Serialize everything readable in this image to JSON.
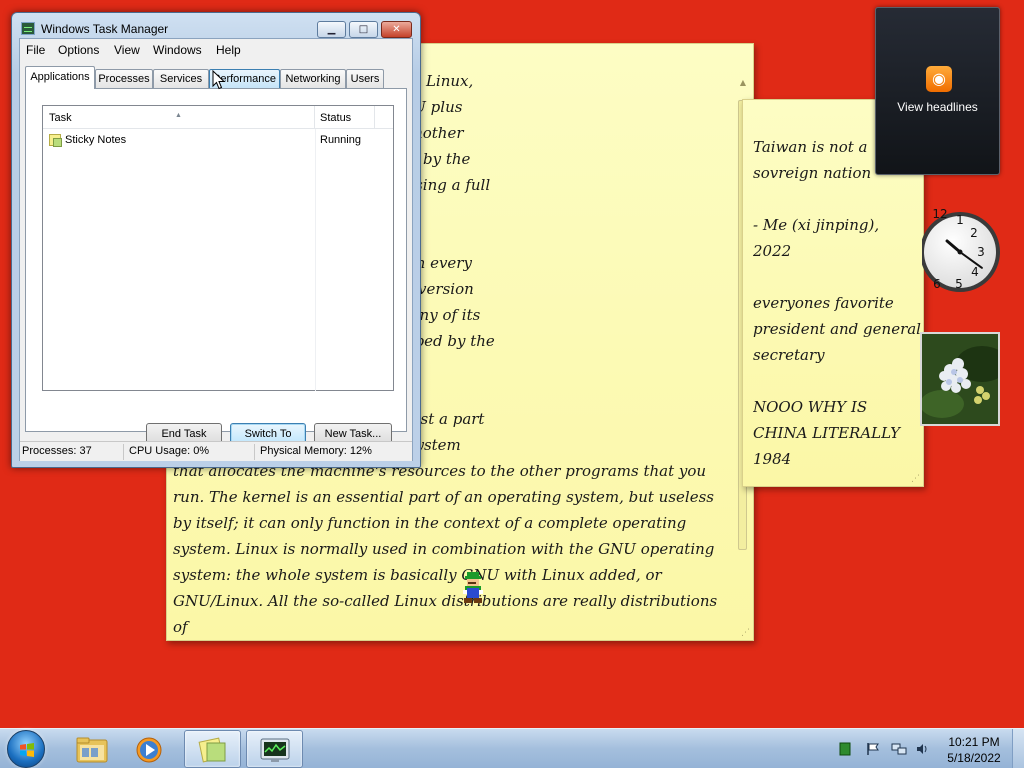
{
  "notes": {
    "main": {
      "text": "ment. What you're refering to as Linux,\n recently taken to calling it, GNU plus\n system unto itself, but rather another\n oning GNU system made useful by the\n ital system components comprising a full\n\n\n lified version of the GNU system every\n h a peculiar turn of events, the version\n ay is often called Linux, and many of its\n sically the GNU system, developed by the\n\n\n e people are using it, but it is just a part\n he kernel: the program in the system\nthat allocates the machine's resources to the other programs that you\nrun. The kernel is an essential part of an operating system, but useless\nby itself; it can only function in the context of a complete operating\nsystem. Linux is normally used in combination with the GNU operating\nsystem: the whole system is basically GNU with Linux added, or\nGNU/Linux. All the so-called Linux distributions are really distributions of\nGNU/Linux!"
    },
    "second": {
      "text": "Taiwan is not a\nsovreign nation\n\n- Me (xi jinping),\n2022\n\neveryones favorite\npresident and general\nsecretary\n\nNOOO WHY IS\nCHINA LITERALLY\n1984"
    }
  },
  "feed_gadget": {
    "label": "View headlines",
    "icon": "rss-icon"
  },
  "clock_gadget": {
    "hour": 10,
    "minute": 21
  },
  "task_manager": {
    "title": "Windows Task Manager",
    "title_buttons": {
      "minimize": "▁",
      "maximize": "□",
      "close": "✕"
    },
    "menu": [
      "File",
      "Options",
      "View",
      "Windows",
      "Help"
    ],
    "tabs": [
      "Applications",
      "Processes",
      "Services",
      "Performance",
      "Networking",
      "Users"
    ],
    "active_tab": "Applications",
    "columns": {
      "task": "Task",
      "status": "Status"
    },
    "rows": [
      {
        "task": "Sticky Notes",
        "status": "Running"
      }
    ],
    "buttons": {
      "end_task": "End Task",
      "switch_to": "Switch To",
      "new_task": "New Task..."
    },
    "status_bar": {
      "processes": "Processes: 37",
      "cpu": "CPU Usage: 0%",
      "memory": "Physical Memory: 12%"
    }
  },
  "taskbar": {
    "pinned": [
      "explorer-icon",
      "media-player-icon"
    ],
    "open": [
      "sticky-notes-icon",
      "task-manager-icon"
    ],
    "tray_icons": [
      "green-square-icon",
      "flag-icon",
      "network-icon",
      "volume-icon"
    ],
    "time": "10:21 PM",
    "date": "5/18/2022"
  },
  "colors": {
    "desktop": "#e02a16",
    "note": "#fdf9b4",
    "taskbar": "#a4bfdd"
  }
}
